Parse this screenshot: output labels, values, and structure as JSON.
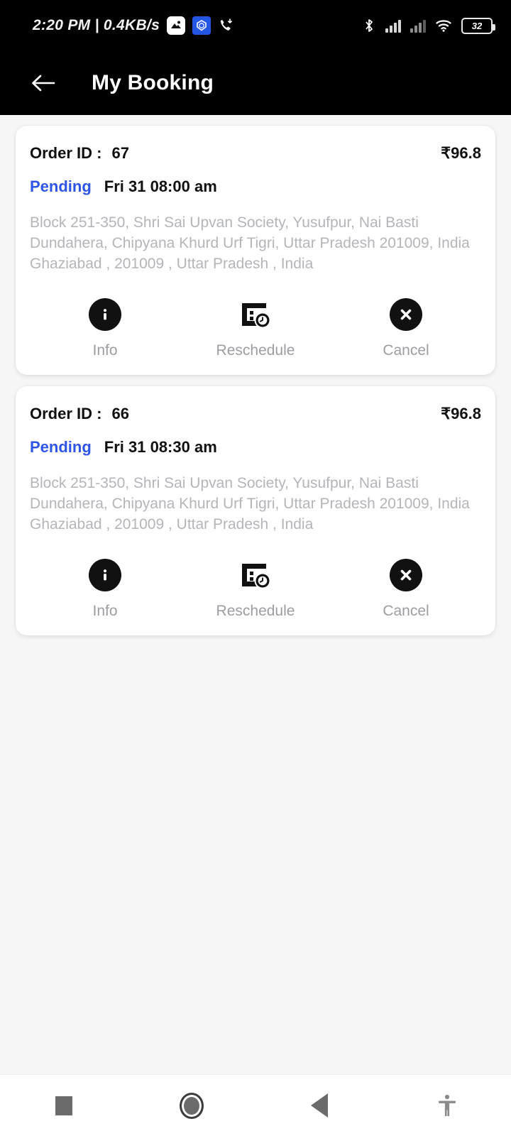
{
  "statusbar": {
    "clock": "2:20 PM | 0.4KB/s",
    "icons": {
      "app_white": "image-app-icon",
      "app_blue": "shield-app-icon",
      "missed_call": "missed-call-icon",
      "bluetooth": "bluetooth-icon",
      "signal_one": "signal-bars-icon",
      "signal_two": "signal-bars-icon",
      "wifi": "wifi-icon",
      "battery": "battery-icon"
    },
    "battery_level": "32"
  },
  "appbar": {
    "back_icon": "arrow-left-icon",
    "title": "My Booking"
  },
  "theme": {
    "status_color": "#2f55e8",
    "page_bg": "#f6f6f7",
    "card_bg": "#ffffff",
    "icon_dark": "#111111",
    "muted_text": "#b3b5b9",
    "label_text": "#9b9da1"
  },
  "bookings": [
    {
      "order_label": "Order ID :",
      "order_id": "67",
      "price": "₹96.8",
      "status": "Pending",
      "datetime": "Fri 31 08:00 am",
      "address": "Block 251-350, Shri Sai Upvan Society, Yusufpur, Nai Basti Dundahera, Chipyana Khurd Urf Tigri, Uttar Pradesh 201009, India Ghaziabad , 201009 , Uttar Pradesh , India",
      "actions": [
        {
          "label": "Info",
          "icon": "info-circle-icon"
        },
        {
          "label": "Reschedule",
          "icon": "calendar-clock-icon"
        },
        {
          "label": "Cancel",
          "icon": "close-circle-icon"
        }
      ]
    },
    {
      "order_label": "Order ID :",
      "order_id": "66",
      "price": "₹96.8",
      "status": "Pending",
      "datetime": "Fri 31 08:30 am",
      "address": "Block 251-350, Shri Sai Upvan Society, Yusufpur, Nai Basti Dundahera, Chipyana Khurd Urf Tigri, Uttar Pradesh 201009, India Ghaziabad , 201009 , Uttar Pradesh , India",
      "actions": [
        {
          "label": "Info",
          "icon": "info-circle-icon"
        },
        {
          "label": "Reschedule",
          "icon": "calendar-clock-icon"
        },
        {
          "label": "Cancel",
          "icon": "close-circle-icon"
        }
      ]
    }
  ],
  "navbar": {
    "items": [
      {
        "name": "recents-button",
        "icon": "square-icon"
      },
      {
        "name": "home-button",
        "icon": "circle-icon"
      },
      {
        "name": "back-button",
        "icon": "triangle-left-icon"
      },
      {
        "name": "accessibility-button",
        "icon": "accessibility-icon"
      }
    ]
  }
}
